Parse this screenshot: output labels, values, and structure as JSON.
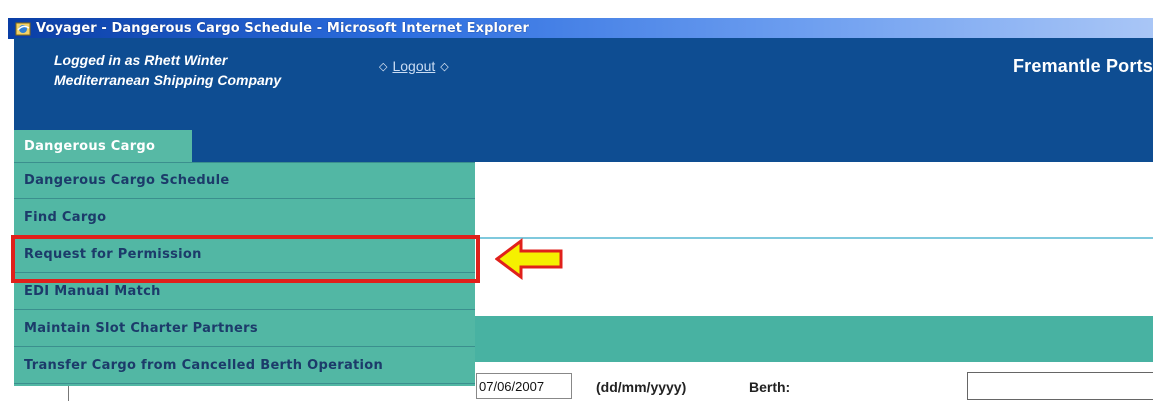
{
  "window": {
    "title": "Voyager - Dangerous Cargo Schedule - Microsoft Internet Explorer",
    "icon": "ie-icon"
  },
  "header": {
    "login_line1": "Logged in as Rhett Winter",
    "login_line2": "Mediterranean Shipping Company",
    "logout_label": "Logout",
    "org_name": "Fremantle Ports",
    "menu_tab_label": "Dangerous Cargo"
  },
  "menu": {
    "items": [
      {
        "label": "Dangerous Cargo Schedule"
      },
      {
        "label": "Find Cargo"
      },
      {
        "label": "Request for Permission",
        "highlighted": true
      },
      {
        "label": "EDI Manual Match"
      },
      {
        "label": "Maintain Slot Charter Partners"
      },
      {
        "label": "Transfer Cargo from Cancelled Berth Operation"
      }
    ]
  },
  "filters": {
    "end_date_value": "07/06/2007",
    "date_format_hint": "(dd/mm/yyyy)",
    "berth_label": "Berth:",
    "berth_value": ""
  },
  "colors": {
    "header_bg": "#0e4d92",
    "menu_bg": "#52b7a4",
    "menu_text": "#1c3b6a",
    "highlight": "#e0201b",
    "arrow_fill": "#f5f000"
  }
}
